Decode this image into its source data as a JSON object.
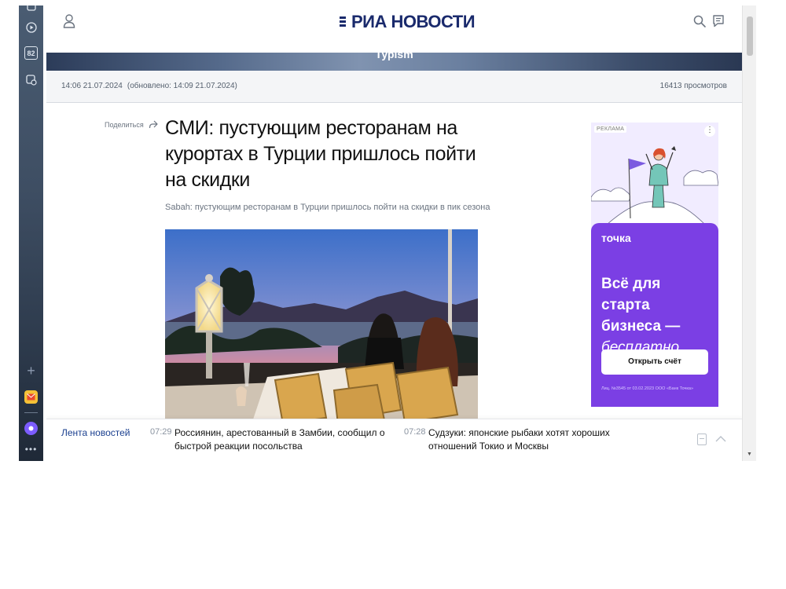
{
  "browser": {
    "counter_badge": "82"
  },
  "header": {
    "logo_text": "РИА НОВОСТИ",
    "banner_title": "Турism"
  },
  "article": {
    "published": "14:06 21.07.2024",
    "updated": "(обновлено: 14:09 21.07.2024)",
    "views": "16413 просмотров",
    "share_label": "Поделиться",
    "title": "СМИ: пустующим ресторанам на курортах в Турции пришлось пойти на скидки",
    "subtitle": "Sabah: пустующим ресторанам в Турции пришлось пойти на скидки в пик сезона"
  },
  "ad": {
    "label": "РЕКЛАМА",
    "menu": "⋮",
    "brand": "точка",
    "headline": "Всё для старта бизнеса —",
    "headline_em": "бесплатно",
    "cta": "Открыть счёт",
    "legal": "Лиц. №3545 от 03.02.2023 ООО «Банк Точка»"
  },
  "ticker": {
    "label": "Лента новостей",
    "items": [
      {
        "time": "07:29",
        "text": "Россиянин, арестованный в Замбии, сообщил о быстрой реакции посольства"
      },
      {
        "time": "07:28",
        "text": "Судзуки: японские рыбаки хотят хороших отношений Токио и Москвы"
      }
    ]
  },
  "colors": {
    "brand_navy": "#1a2a6c",
    "ad_purple": "#7b3fe4",
    "ticker_label": "#1a3f8f"
  }
}
